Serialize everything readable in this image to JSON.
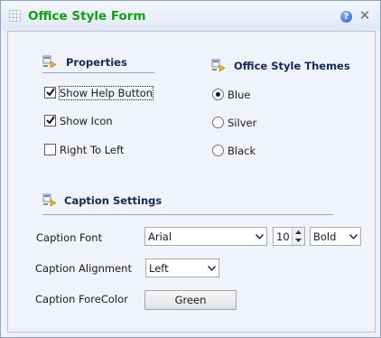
{
  "window": {
    "title": "Office Style Form",
    "help_icon": "help-icon",
    "help_glyph": "?",
    "close_icon": "close-icon",
    "close_glyph": "✕",
    "title_color": "#119f11"
  },
  "properties": {
    "title": "Properties",
    "options": [
      {
        "label": "Show Help Button",
        "checked": true
      },
      {
        "label": "Show Icon",
        "checked": true
      },
      {
        "label": "Right To Left",
        "checked": false
      }
    ]
  },
  "themes": {
    "title": "Office Style Themes",
    "options": [
      {
        "label": "Blue",
        "selected": true
      },
      {
        "label": "Silver",
        "selected": false
      },
      {
        "label": "Black",
        "selected": false
      }
    ]
  },
  "caption": {
    "title": "Caption Settings",
    "font_label": "Caption Font",
    "font_value": "Arial",
    "size_value": "10",
    "style_value": "Bold",
    "alignment_label": "Caption Alignment",
    "alignment_value": "Left",
    "forecolor_label": "Caption ForeColor",
    "forecolor_button": "Green"
  }
}
